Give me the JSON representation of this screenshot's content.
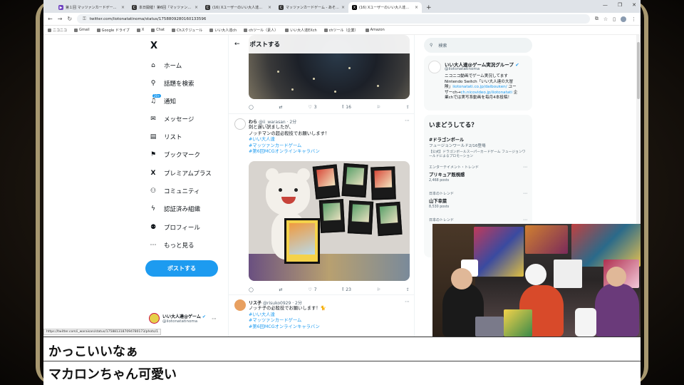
{
  "browser": {
    "tabs": [
      {
        "label": "第１回 マッツァンカードゲーム 入手...",
        "color": "#6f42c1",
        "icon": "youtube-icon",
        "active": false
      },
      {
        "label": "本日開催！第6回『マッツァンカード...",
        "color": "#333333",
        "icon": "c-icon",
        "active": false
      },
      {
        "label": "(16) Xユーザーのいい大人達のゲ...",
        "color": "#333333",
        "icon": "c-icon",
        "active": false
      },
      {
        "label": "マッツァンカードゲーム - あそびさ...",
        "color": "#333333",
        "icon": "c-icon",
        "active": false
      },
      {
        "label": "(16) Xユーザーのいい大人達のゲ...",
        "color": "#000000",
        "icon": "x-icon",
        "active": true
      }
    ],
    "url": "twitter.com/iiotonatatinoma/status/1758809280160133596",
    "bookmarks": [
      "ニコニコ",
      "Gmail",
      "Google ドライブ",
      "X",
      "Chat",
      "Chスケジュール",
      "いい大人達ch",
      "chツール（素人）",
      "いい大人達EXch",
      "chツール（企業）",
      "Amazon"
    ]
  },
  "sidebar": {
    "logo": "X",
    "items": [
      {
        "label": "ホーム",
        "icon": "home-icon",
        "glyph": "⌂"
      },
      {
        "label": "話題を検索",
        "icon": "search-icon",
        "glyph": "⚲"
      },
      {
        "label": "通知",
        "icon": "bell-icon",
        "glyph": "♫",
        "badge": "20+"
      },
      {
        "label": "メッセージ",
        "icon": "mail-icon",
        "glyph": "✉"
      },
      {
        "label": "リスト",
        "icon": "list-icon",
        "glyph": "▤"
      },
      {
        "label": "ブックマーク",
        "icon": "bookmark-icon",
        "glyph": "⚑"
      },
      {
        "label": "プレミアムプラス",
        "icon": "x-icon",
        "glyph": "X"
      },
      {
        "label": "コミュニティ",
        "icon": "community-icon",
        "glyph": "⚇"
      },
      {
        "label": "認証済み組織",
        "icon": "lightning-icon",
        "glyph": "ϟ"
      },
      {
        "label": "プロフィール",
        "icon": "profile-icon",
        "glyph": "⚉"
      },
      {
        "label": "もっと見る",
        "icon": "more-icon",
        "glyph": "⋯"
      }
    ],
    "post_button": "ポストする",
    "account": {
      "name": "いい大人達@ゲーム",
      "handle": "@iiotonatatinoma",
      "verified": "✔"
    },
    "status_link": "https://twitter.com/i_waraisan/status/1758813187094780173/photo/1"
  },
  "timeline": {
    "title": "ポストする",
    "first_actions": {
      "reply": "",
      "retweet": "",
      "like": "3",
      "views": "16"
    },
    "tweets": [
      {
        "name": "わら",
        "handle": "@ii_warasan",
        "time": "2分",
        "lines": [
          "刺と遅い訳ましたが、",
          "ノッチマンの超必殺技でお願いします！"
        ],
        "tags": [
          "#いい大人達",
          "#マッツァンカードゲーム",
          "#第6回MCGオンラインキャラバン"
        ],
        "actions": {
          "reply": "",
          "retweet": "",
          "like": "7",
          "views": "23"
        }
      },
      {
        "name": "リス子",
        "handle": "@risuko0929",
        "time": "2分",
        "lines": [
          "ノッチ子の必殺技でお願いします！🐈"
        ],
        "tags": [
          "#いい大人達",
          "#マッツァンカードゲーム",
          "#第6回MCGオンラインキャラバン"
        ]
      }
    ]
  },
  "right": {
    "search_placeholder": "検索",
    "profile": {
      "name": "いい大人達@ゲーム実況グループ",
      "handle": "@iiotonatatinoma",
      "bio_1": "ニコニコ動画でゲーム実況してます",
      "bio_2": "Nintendo Switch「いい大人達の大冒",
      "bio_3": "険」",
      "bio_link1": "iiotonatati.co.jp/daibouken/",
      "bio_4": "ユー",
      "bio_5": "ザーch→",
      "bio_link2": "ch.nicovideo.jp/iiotonatati",
      "bio_6": "企",
      "bio_7": "業chでは実写系動画を毎月4本投稿！"
    },
    "trends_title": "いまどうしてる？",
    "trends": [
      {
        "category": "",
        "name": "#ドラゴンボール",
        "count": "フュージョンワールド2/16登場",
        "extra": "【公式】ドラゴンボールスーパーカードゲーム フュージョンワールドによるプロモーション"
      },
      {
        "category": "エンターテイメント・トレンド",
        "name": "プリキュア既視感",
        "count": "2,468 posts"
      },
      {
        "category": "日本のトレンド",
        "name": "山下幸菜",
        "count": "8,530 posts"
      },
      {
        "category": "日本のトレンド",
        "name": "",
        "count": ""
      }
    ]
  },
  "subtitles": [
    "かっこいいなぁ",
    "マカロンちゃん可愛い"
  ]
}
